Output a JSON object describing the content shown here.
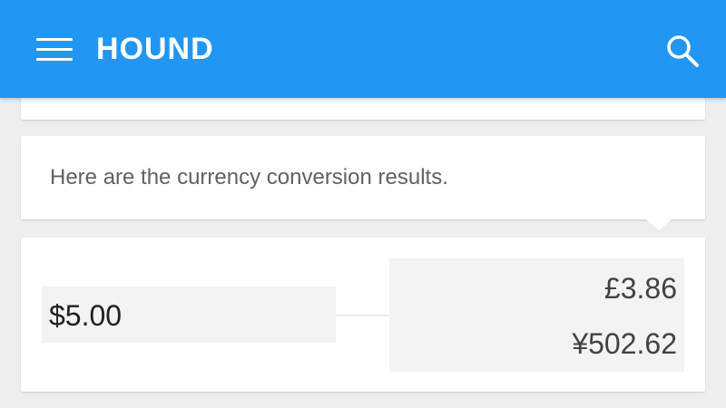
{
  "app_bar": {
    "title": "HOUND",
    "menu_icon": "hamburger-menu-icon",
    "search_icon": "search-icon",
    "color": "#2196f3"
  },
  "message": {
    "text": "Here are the currency conversion results."
  },
  "conversion": {
    "from_amount": "$5.00",
    "results": [
      "£3.86",
      "¥502.62"
    ]
  }
}
